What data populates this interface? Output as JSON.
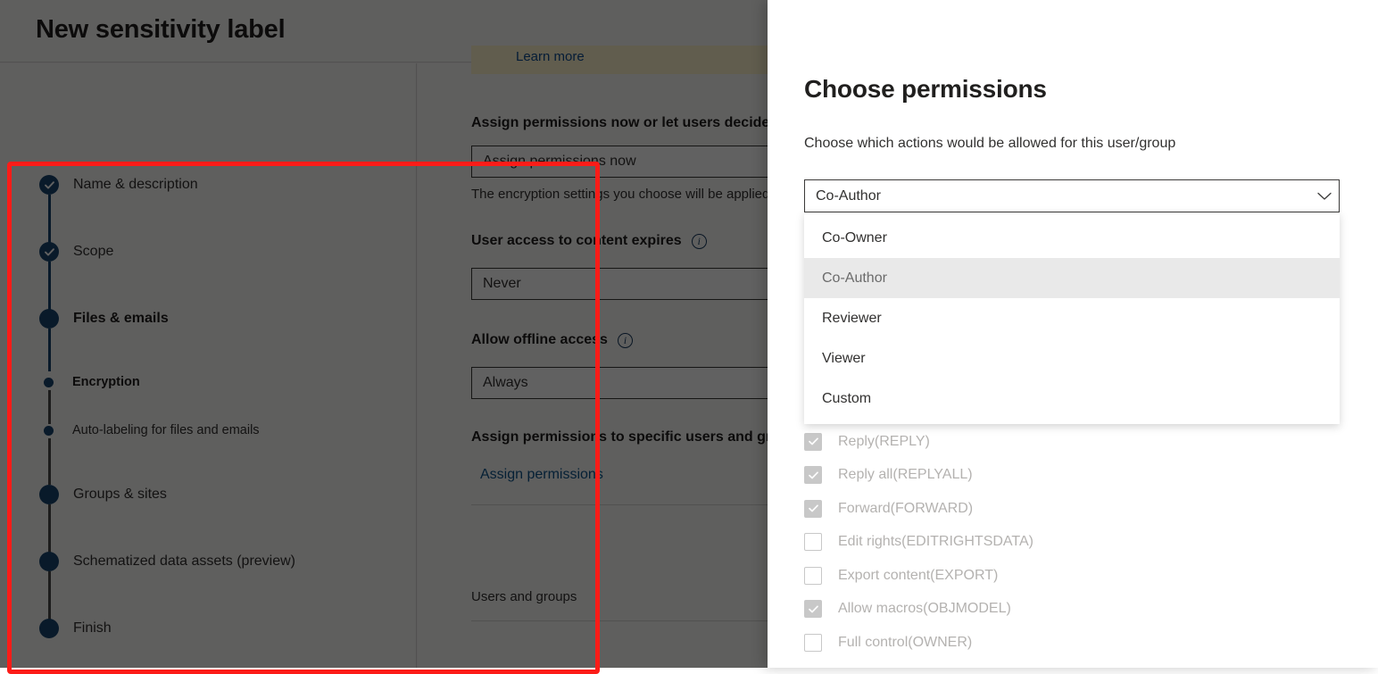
{
  "wizard": {
    "title": "New sensitivity label",
    "steps": [
      {
        "label": "Name & description",
        "state": "done",
        "style": "normal"
      },
      {
        "label": "Scope",
        "state": "done",
        "style": "normal"
      },
      {
        "label": "Files & emails",
        "state": "current",
        "style": "bold"
      },
      {
        "label": "Encryption",
        "state": "sub",
        "style": "bold"
      },
      {
        "label": "Auto-labeling for files and emails",
        "state": "sub",
        "style": "normal"
      },
      {
        "label": "Groups & sites",
        "state": "pending",
        "style": "normal"
      },
      {
        "label": "Schematized data assets (preview)",
        "state": "pending",
        "style": "normal"
      },
      {
        "label": "Finish",
        "state": "pending",
        "style": "normal"
      }
    ]
  },
  "form": {
    "banner_link": "Learn more",
    "assign_permissions_heading": "Assign permissions now or let users decide?",
    "assign_permissions_value": "Assign permissions now",
    "assign_permissions_helper": "The encryption settings you choose will be applied",
    "expiry_heading": "User access to content expires",
    "expiry_value": "Never",
    "offline_heading": "Allow offline access",
    "offline_value": "Always",
    "specific_users_heading": "Assign permissions to specific users and groups",
    "assign_permissions_link": "Assign permissions",
    "users_and_groups_label": "Users and groups",
    "info_icon_glyph": "i"
  },
  "flyout": {
    "title": "Choose permissions",
    "subtitle": "Choose which actions would be allowed for this user/group",
    "combobox": {
      "value": "Co-Author",
      "chevron_icon": "chevron-down-icon"
    },
    "options": [
      {
        "label": "Co-Owner",
        "selected": false
      },
      {
        "label": "Co-Author",
        "selected": true
      },
      {
        "label": "Reviewer",
        "selected": false
      },
      {
        "label": "Viewer",
        "selected": false
      },
      {
        "label": "Custom",
        "selected": false
      }
    ],
    "permission_checkboxes": [
      {
        "label": "Reply(REPLY)",
        "checked": true
      },
      {
        "label": "Reply all(REPLYALL)",
        "checked": true
      },
      {
        "label": "Forward(FORWARD)",
        "checked": true
      },
      {
        "label": "Edit rights(EDITRIGHTSDATA)",
        "checked": false
      },
      {
        "label": "Export content(EXPORT)",
        "checked": false
      },
      {
        "label": "Allow macros(OBJMODEL)",
        "checked": true
      },
      {
        "label": "Full control(OWNER)",
        "checked": false
      }
    ]
  },
  "annotation": {
    "highlight_color": "#fc1c18"
  },
  "colors": {
    "accent_blue": "#18446e",
    "link_blue": "#0f548c",
    "overlay": "#5a5a5a",
    "panel_bg": "#ffffff",
    "selected_option_bg": "#e9e9e9",
    "banner_bg": "#fff4ce"
  }
}
